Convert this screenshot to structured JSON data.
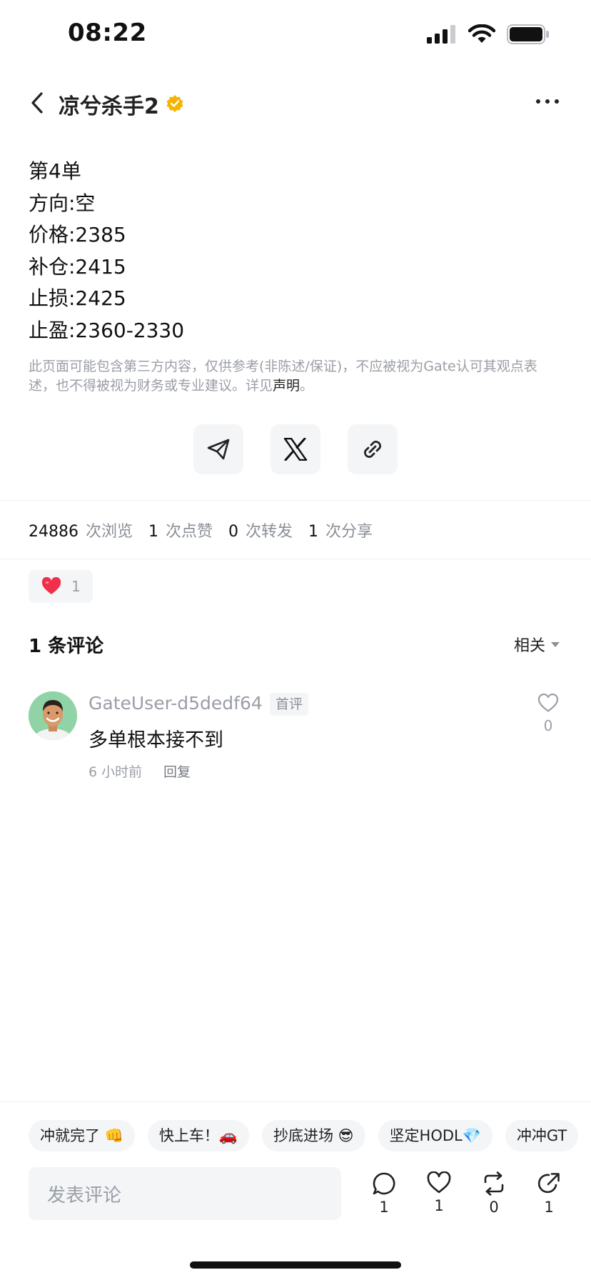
{
  "status_bar": {
    "time": "08:22"
  },
  "header": {
    "author": "凉兮杀手2"
  },
  "post": {
    "lines": [
      "第4单",
      "方向:空",
      "价格:2385",
      "补仓:2415",
      "止损:2425",
      "止盈:2360-2330"
    ],
    "disclaimer_prefix": "此页面可能包含第三方内容，仅供参考(非陈述/保证)，不应被视为Gate认可其观点表述，也不得被视为财务或专业建议。详见",
    "disclaimer_link": "声明",
    "disclaimer_suffix": "。"
  },
  "stats": {
    "views": "24886",
    "views_label": "次浏览",
    "likes": "1",
    "likes_label": "次点赞",
    "reposts": "0",
    "reposts_label": "次转发",
    "shares": "1",
    "shares_label": "次分享"
  },
  "reaction": {
    "count": "1",
    "color": "#f0304a"
  },
  "comments": {
    "title": "1 条评论",
    "sort_label": "相关",
    "items": [
      {
        "user": "GateUser-d5dedf64",
        "badge": "首评",
        "text": "多单根本接不到",
        "time": "6 小时前",
        "reply": "回复",
        "likes": "0"
      }
    ]
  },
  "quick_replies": [
    "冲就完了 👊",
    "快上车！🚗",
    "抄底进场 😎",
    "坚定HODL💎",
    "冲冲GT"
  ],
  "bottom_bar": {
    "placeholder": "发表评论",
    "comments": "1",
    "likes": "1",
    "reposts": "0",
    "shares": "1"
  },
  "colors": {
    "verified": "#f5b400",
    "primary_text": "#111111",
    "muted_text": "#9a9ea6"
  }
}
